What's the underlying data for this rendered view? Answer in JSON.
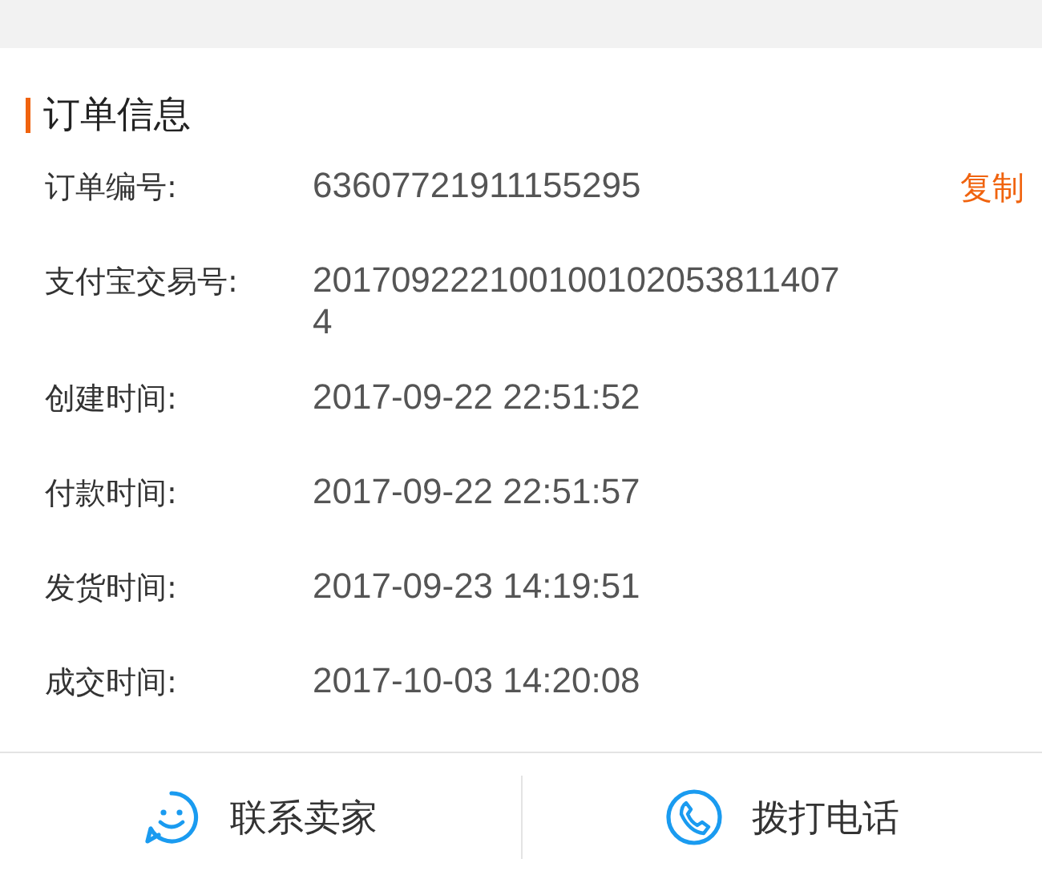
{
  "section": {
    "title": "订单信息"
  },
  "rows": [
    {
      "label": "订单编号:",
      "value": "63607721911155295",
      "action": "复制"
    },
    {
      "label": "支付宝交易号:",
      "value": "2017092221001001020538114074"
    },
    {
      "label": "创建时间:",
      "value": "2017-09-22 22:51:52"
    },
    {
      "label": "付款时间:",
      "value": "2017-09-22 22:51:57"
    },
    {
      "label": "发货时间:",
      "value": "2017-09-23 14:19:51"
    },
    {
      "label": "成交时间:",
      "value": "2017-10-03 14:20:08"
    }
  ],
  "footer": [
    {
      "kind": "chat",
      "label": "联系卖家"
    },
    {
      "kind": "phone",
      "label": "拨打电话"
    }
  ]
}
